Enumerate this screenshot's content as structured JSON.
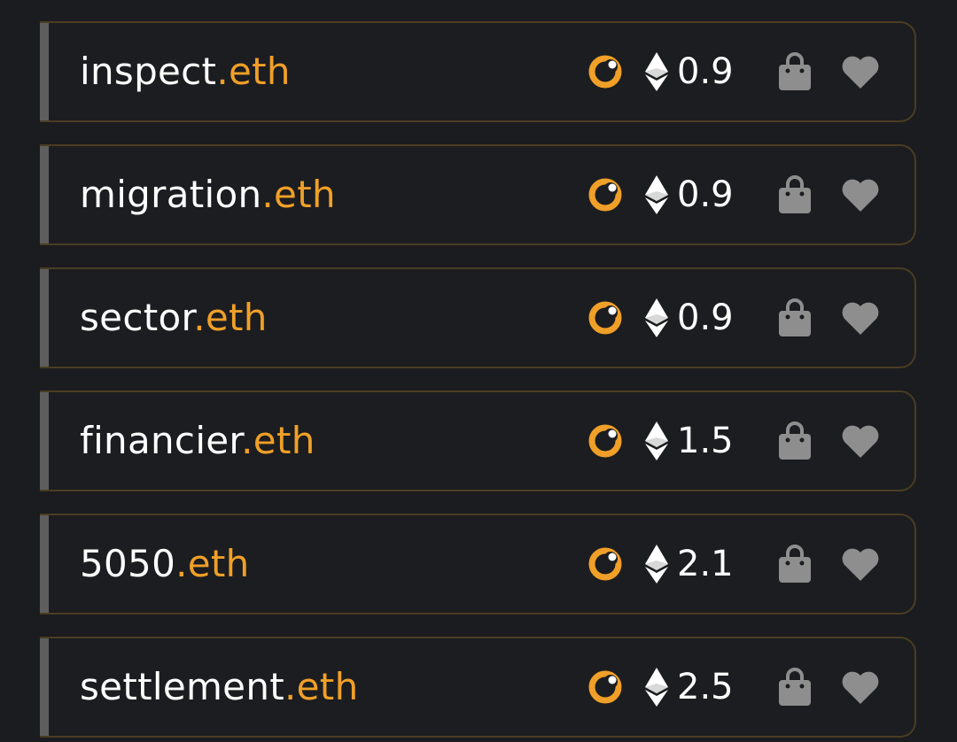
{
  "colors": {
    "background": "#1b1c1f",
    "accent_orange": "#f0a028",
    "row_border": "#4a3d22",
    "left_bar": "#5e5e5e",
    "icon_gray": "#8e8e8e"
  },
  "icons": {
    "marketplace": "marketplace-icon",
    "currency": "ethereum-icon",
    "buy": "shopping-bag-icon",
    "favorite": "heart-icon"
  },
  "domains": [
    {
      "label": "inspect",
      "tld": ".eth",
      "price": "0.9"
    },
    {
      "label": "migration",
      "tld": ".eth",
      "price": "0.9"
    },
    {
      "label": "sector",
      "tld": ".eth",
      "price": "0.9"
    },
    {
      "label": "financier",
      "tld": ".eth",
      "price": "1.5"
    },
    {
      "label": "5050",
      "tld": ".eth",
      "price": "2.1"
    },
    {
      "label": "settlement",
      "tld": ".eth",
      "price": "2.5"
    }
  ]
}
